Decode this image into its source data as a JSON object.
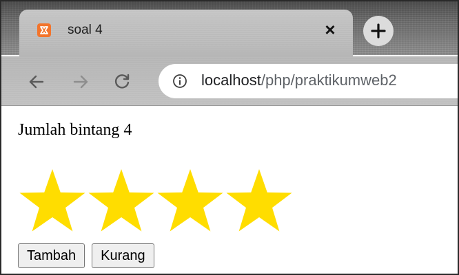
{
  "browser": {
    "tab": {
      "title": "soal 4",
      "close_glyph": "×",
      "favicon": "xampp-icon"
    },
    "new_tab_glyph": "+",
    "address_bar": {
      "host": "localhost",
      "path": "/php/praktikumweb2",
      "info_icon": "info-icon"
    },
    "nav": {
      "back": "back-arrow-icon",
      "forward": "forward-arrow-icon",
      "reload": "reload-icon"
    }
  },
  "page": {
    "text": "Jumlah bintang 4",
    "star_count": 4,
    "star_color": "#ffdd00",
    "buttons": {
      "add_label": "Tambah",
      "subtract_label": "Kurang"
    }
  }
}
